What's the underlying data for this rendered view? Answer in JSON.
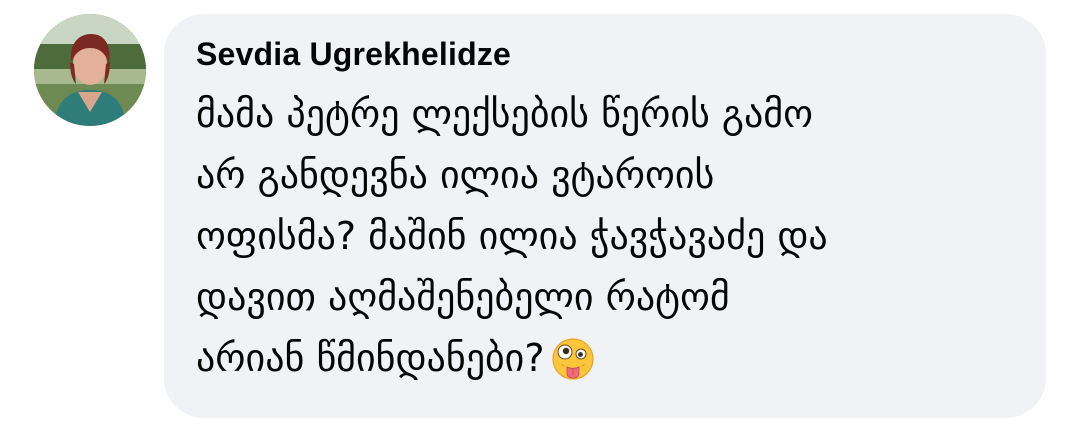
{
  "comment": {
    "author": "Sevdia Ugrekhelidze",
    "lines": [
      "მამა პეტრე ლექსების წერის გამო",
      "არ განდევნა ილია ვტაროის",
      "ოფისმა? მაშინ ილია ჭავჭავაძე და",
      "დავით აღმაშენებელი რატომ",
      "არიან წმინდანები?"
    ],
    "emoji_icon": "zany-face-emoji",
    "bubble_color": "#f0f2f5",
    "text_color": "#050505"
  }
}
